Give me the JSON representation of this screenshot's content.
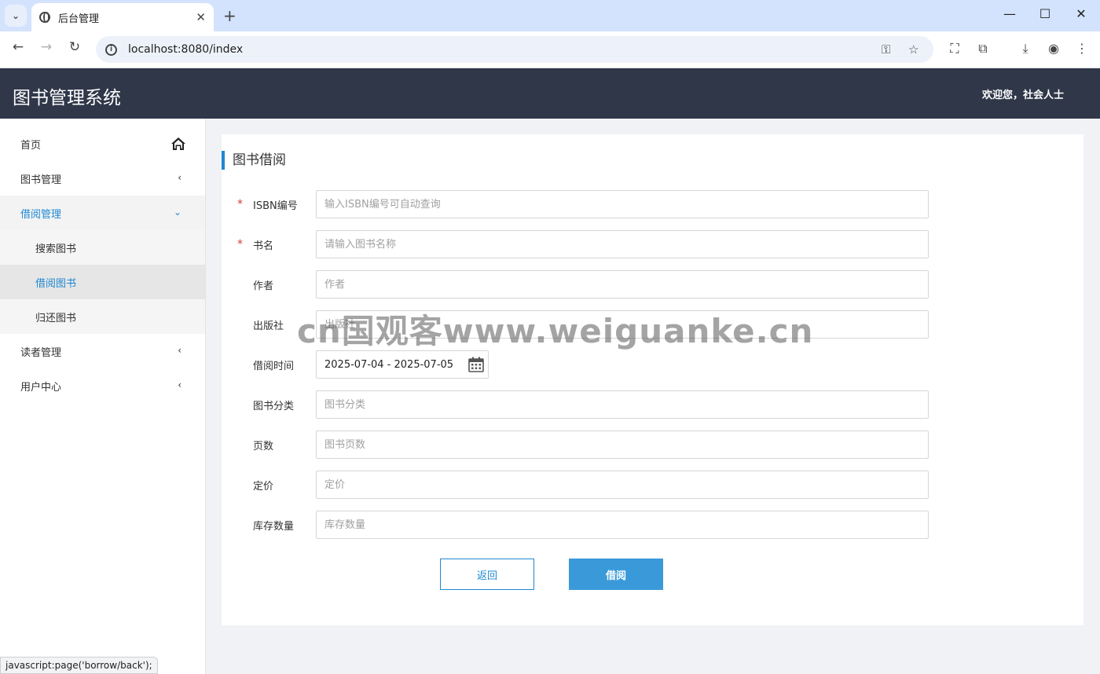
{
  "browser": {
    "tab_title": "后台管理",
    "url": "localhost:8080/index",
    "status_text": "javascript:page('borrow/back');"
  },
  "header": {
    "title": "图书管理系统",
    "welcome": "欢迎您，社会人士"
  },
  "sidebar": {
    "items": [
      {
        "label": "首页"
      },
      {
        "label": "图书管理"
      },
      {
        "label": "借阅管理"
      },
      {
        "label": "读者管理"
      },
      {
        "label": "用户中心"
      }
    ],
    "submenu": [
      {
        "label": "搜索图书"
      },
      {
        "label": "借阅图书"
      },
      {
        "label": "归还图书"
      }
    ]
  },
  "form": {
    "title": "图书借阅",
    "required_mark": "*",
    "fields": {
      "isbn": {
        "label": "ISBN编号",
        "placeholder": "输入ISBN编号可自动查询",
        "value": ""
      },
      "name": {
        "label": "书名",
        "placeholder": "请输入图书名称",
        "value": ""
      },
      "author": {
        "label": "作者",
        "placeholder": "作者",
        "value": ""
      },
      "publisher": {
        "label": "出版社",
        "placeholder": "出版社",
        "value": ""
      },
      "borrow_time": {
        "label": "借阅时间",
        "value": "2025-07-04 - 2025-07-05"
      },
      "category": {
        "label": "图书分类",
        "placeholder": "图书分类",
        "value": ""
      },
      "pages": {
        "label": "页数",
        "placeholder": "图书页数",
        "value": ""
      },
      "price": {
        "label": "定价",
        "placeholder": "定价",
        "value": ""
      },
      "stock": {
        "label": "库存数量",
        "placeholder": "库存数量",
        "value": ""
      }
    },
    "back_button": "返回",
    "borrow_button": "借阅"
  },
  "watermark": "cn国观客www.weiguanke.cn",
  "colors": {
    "header_bg": "#2f3749",
    "accent": "#1e88d2",
    "primary_button": "#3a9ad9",
    "required": "#d23a3a"
  }
}
